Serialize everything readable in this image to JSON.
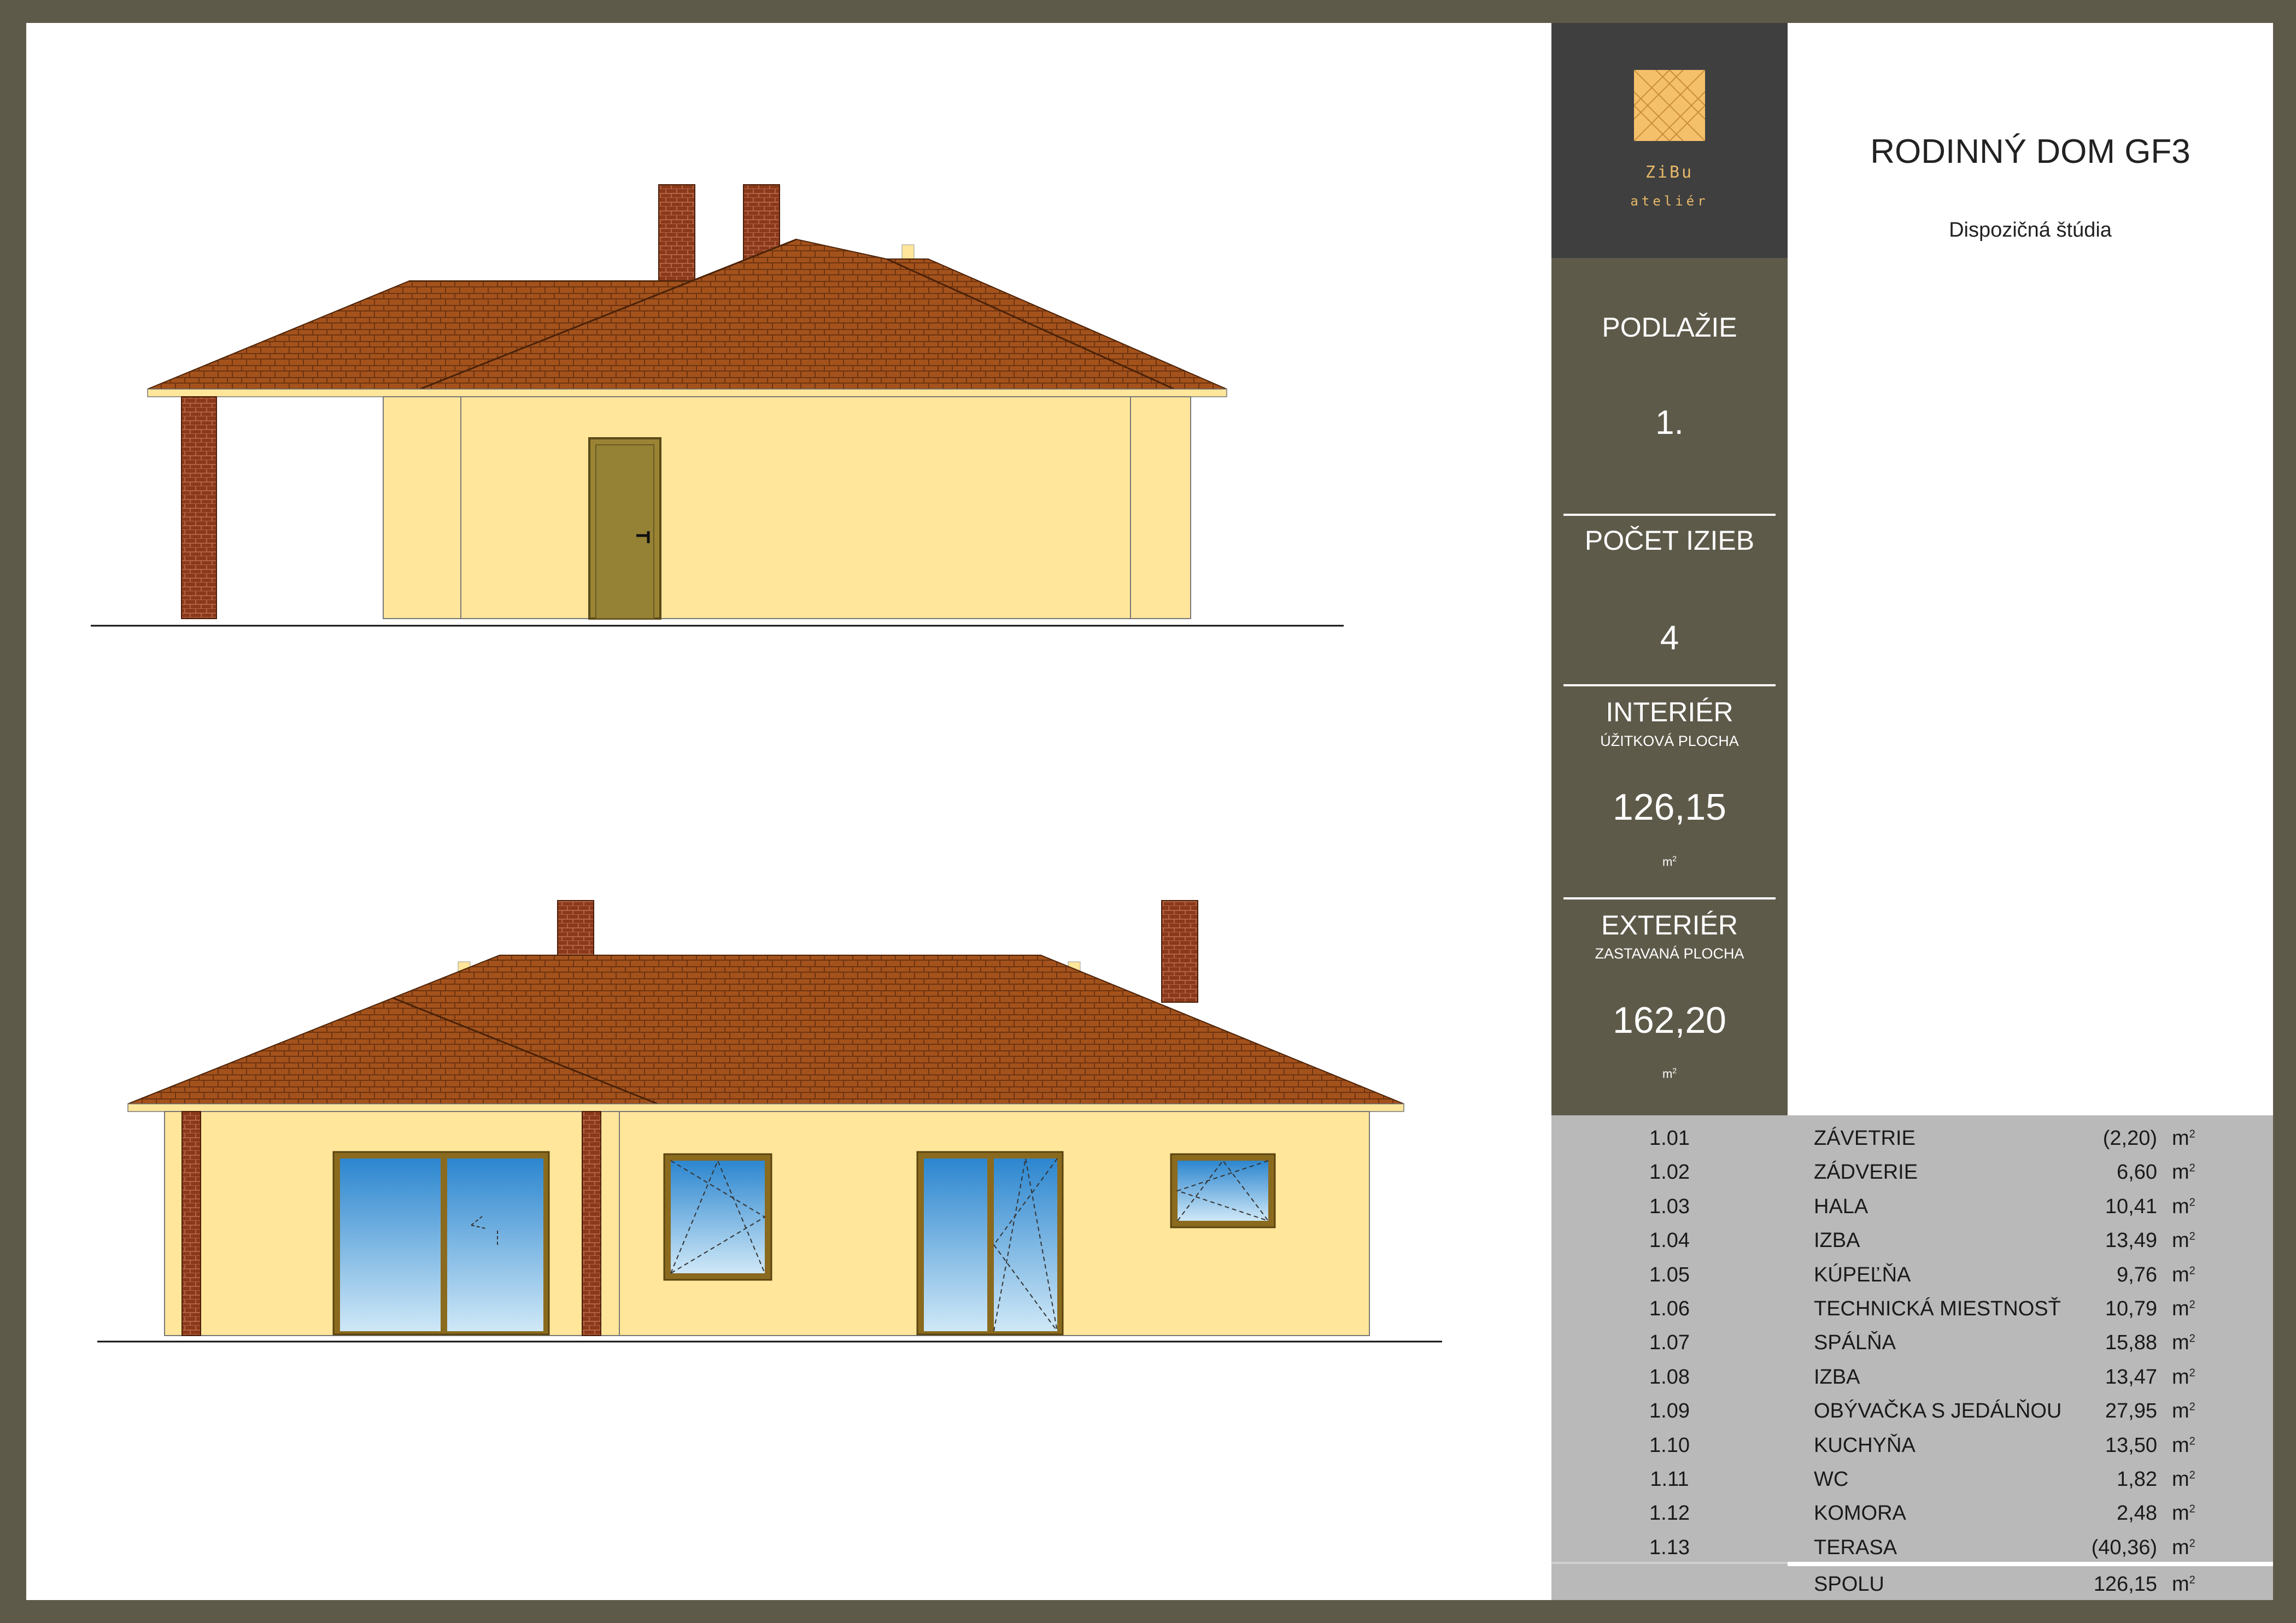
{
  "header": {
    "logo": {
      "name": "ZiBu",
      "subtitle": "ateliér",
      "accent": "#f5c06a"
    },
    "title": "RODINNÝ DOM GF3",
    "subtitle": "Dispozičná štúdia"
  },
  "summary": {
    "floor_label": "PODLAŽIE",
    "floor_value": "1.",
    "rooms_label": "POČET IZIEB",
    "rooms_value": "4",
    "interior_label": "INTERIÉR",
    "interior_sublabel": "ÚŽITKOVÁ PLOCHA",
    "interior_value": "126,15",
    "exterior_label": "EXTERIÉR",
    "exterior_sublabel": "ZASTAVANÁ PLOCHA",
    "exterior_value": "162,20",
    "unit_base": "m",
    "unit_exp": "2"
  },
  "rooms": [
    {
      "id": "1.01",
      "name": "ZÁVETRIE",
      "area": "(2,20)"
    },
    {
      "id": "1.02",
      "name": "ZÁDVERIE",
      "area": "6,60"
    },
    {
      "id": "1.03",
      "name": "HALA",
      "area": "10,41"
    },
    {
      "id": "1.04",
      "name": "IZBA",
      "area": "13,49"
    },
    {
      "id": "1.05",
      "name": "KÚPEĽŇA",
      "area": "9,76"
    },
    {
      "id": "1.06",
      "name": "TECHNICKÁ MIESTNOSŤ",
      "area": "10,79"
    },
    {
      "id": "1.07",
      "name": "SPÁLŇA",
      "area": "15,88"
    },
    {
      "id": "1.08",
      "name": "IZBA",
      "area": "13,47"
    },
    {
      "id": "1.09",
      "name": "OBÝVAČKA S JEDÁLŇOU",
      "area": "27,95"
    },
    {
      "id": "1.10",
      "name": "KUCHYŇA",
      "area": "13,50"
    },
    {
      "id": "1.11",
      "name": "WC",
      "area": "1,82"
    },
    {
      "id": "1.12",
      "name": "KOMORA",
      "area": "2,48"
    },
    {
      "id": "1.13",
      "name": "TERASA",
      "area": "(40,36)"
    }
  ],
  "total": {
    "label": "SPOLU",
    "area": "126,15"
  },
  "colors": {
    "frame": "#5e5a4a",
    "logo_bg": "#3f3f3f",
    "table_bg": "#b9b9b9",
    "wall": "#ffe69a",
    "roof": "#a4521c",
    "brick": "#8a3a1a",
    "glass": "#4aa0d8",
    "frame_trim": "#8a6a1e"
  }
}
